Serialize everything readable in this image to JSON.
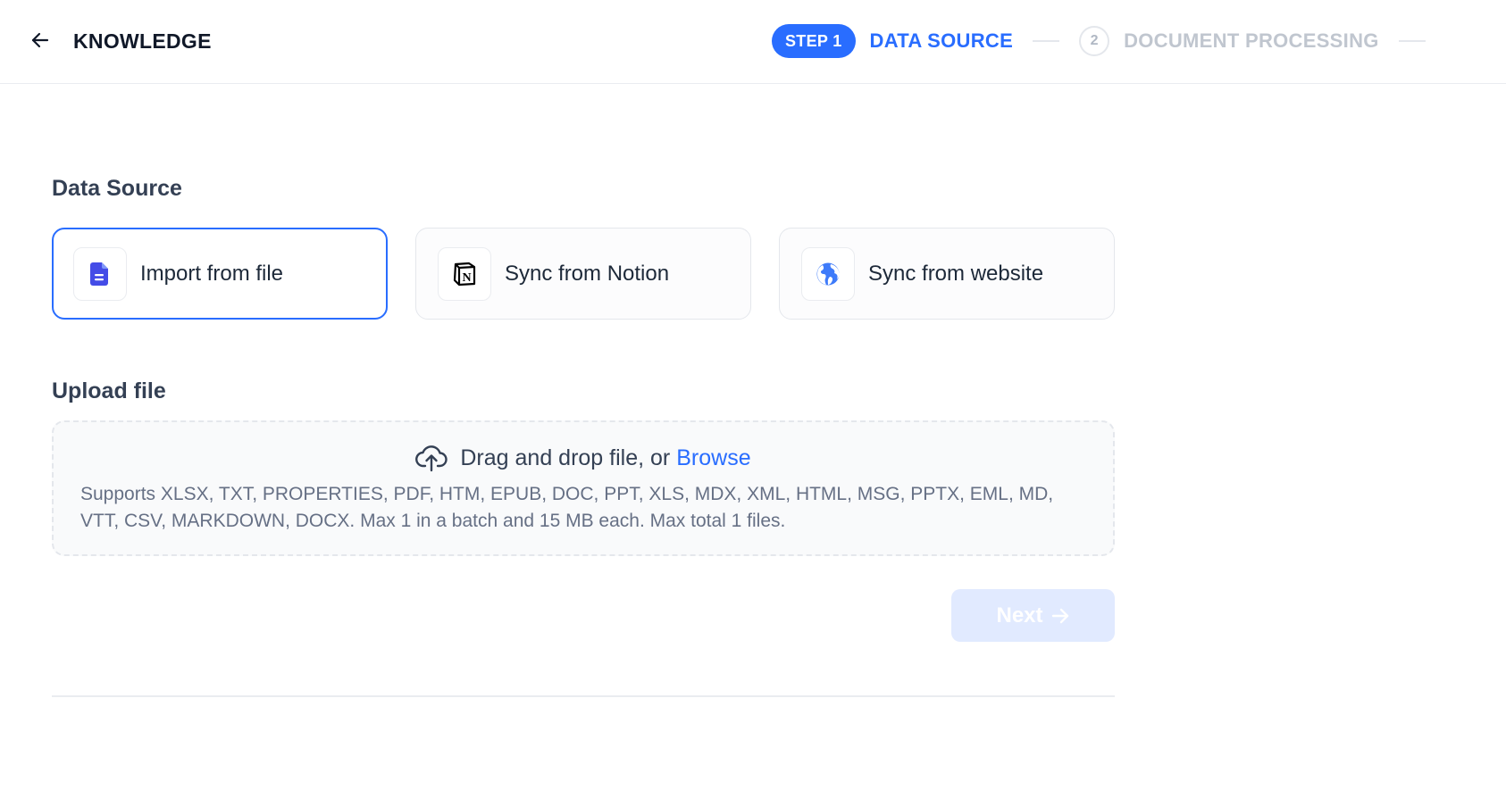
{
  "header": {
    "back_icon": "arrow-left-icon",
    "title": "KNOWLEDGE"
  },
  "steps": [
    {
      "badge": "STEP 1",
      "label": "DATA SOURCE",
      "state": "active"
    },
    {
      "badge": "2",
      "label": "DOCUMENT PROCESSING",
      "state": "inactive"
    }
  ],
  "data_source": {
    "title": "Data Source",
    "options": [
      {
        "label": "Import from file",
        "icon": "file-icon",
        "selected": true
      },
      {
        "label": "Sync from Notion",
        "icon": "notion-icon",
        "selected": false
      },
      {
        "label": "Sync from website",
        "icon": "globe-icon",
        "selected": false
      }
    ]
  },
  "upload": {
    "title": "Upload file",
    "drop_text": "Drag and drop file, or",
    "browse_label": "Browse",
    "hint": "Supports XLSX, TXT, PROPERTIES, PDF, HTM, EPUB, DOC, PPT, XLS, MDX, XML, HTML, MSG, PPTX, EML, MD, VTT, CSV, MARKDOWN, DOCX. Max 1 in a batch and 15 MB each. Max total 1 files."
  },
  "actions": {
    "next_label": "Next",
    "next_enabled": false
  },
  "colors": {
    "accent": "#296dff",
    "file_icon": "#444ce7",
    "globe_icon": "#3e7bfa",
    "next_disabled_bg": "#e1eaff"
  }
}
